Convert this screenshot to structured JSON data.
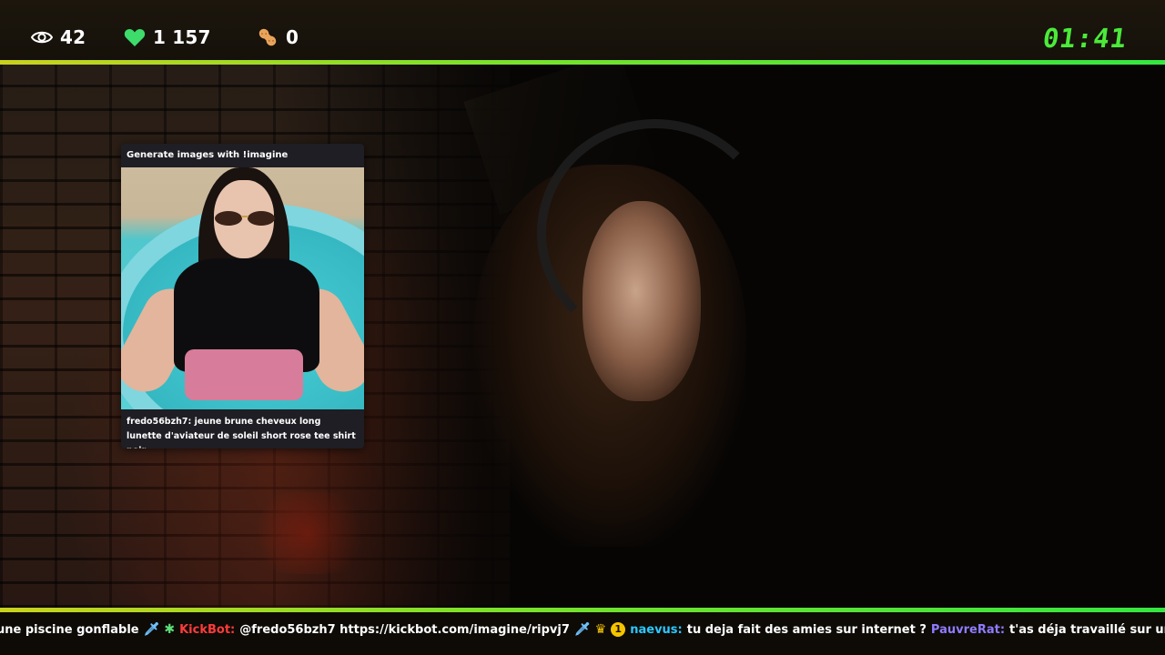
{
  "stats": {
    "viewers": "42",
    "likes": "1 157",
    "subs": "0",
    "timer": "01:41",
    "icons": [
      "eye-icon",
      "heart-icon",
      "peanut-icon"
    ],
    "heart_color": "#3ddc6b",
    "timer_color": "#4bea3a"
  },
  "accent_colors": {
    "line_start": "#c9d21e",
    "line_end": "#35e640"
  },
  "overlay_card": {
    "title": "Generate images with !imagine",
    "caption": "fredo56bzh7: jeune brune cheveux long lunette d'aviateur de soleil short rose tee shirt noir..."
  },
  "ticker": {
    "fragment_1": "une piscine gonflable",
    "user_1": "KickBot:",
    "message_1": "@fredo56bzh7 https://kickbot.com/imagine/ripvj7",
    "badge_number": "1",
    "user_2": "naevus:",
    "message_2": "tu deja fait des amies sur internet ?",
    "user_3": "PauvreRat:",
    "message_3": "t'as déja travaillé sur un tournage?",
    "user_colors": {
      "kickbot": "#ff3b3b",
      "naevus": "#2cc8ff",
      "pauvrerat": "#8f7cff"
    }
  }
}
